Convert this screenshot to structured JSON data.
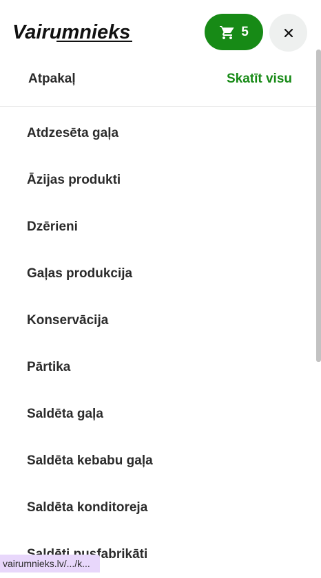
{
  "brand": {
    "logo_text": "Vairumnieks"
  },
  "header": {
    "cart_count": "5",
    "cart_icon": "shopping-cart-icon",
    "close_icon": "close-icon",
    "accent_color": "#178a16"
  },
  "subnav": {
    "back_label": "Atpakaļ",
    "view_all_label": "Skatīt visu"
  },
  "menu": {
    "items": [
      {
        "label": "Atdzesēta gaļa"
      },
      {
        "label": "Āzijas produkti"
      },
      {
        "label": "Dzērieni"
      },
      {
        "label": "Gaļas produkcija"
      },
      {
        "label": "Konservācija"
      },
      {
        "label": "Pārtika"
      },
      {
        "label": "Saldēta gaļa"
      },
      {
        "label": "Saldēta kebabu gaļa"
      },
      {
        "label": "Saldēta konditoreja"
      },
      {
        "label": "Saldēti pusfabrikāti"
      }
    ]
  },
  "status_bar": {
    "url": "vairumnieks.lv/.../k..."
  }
}
